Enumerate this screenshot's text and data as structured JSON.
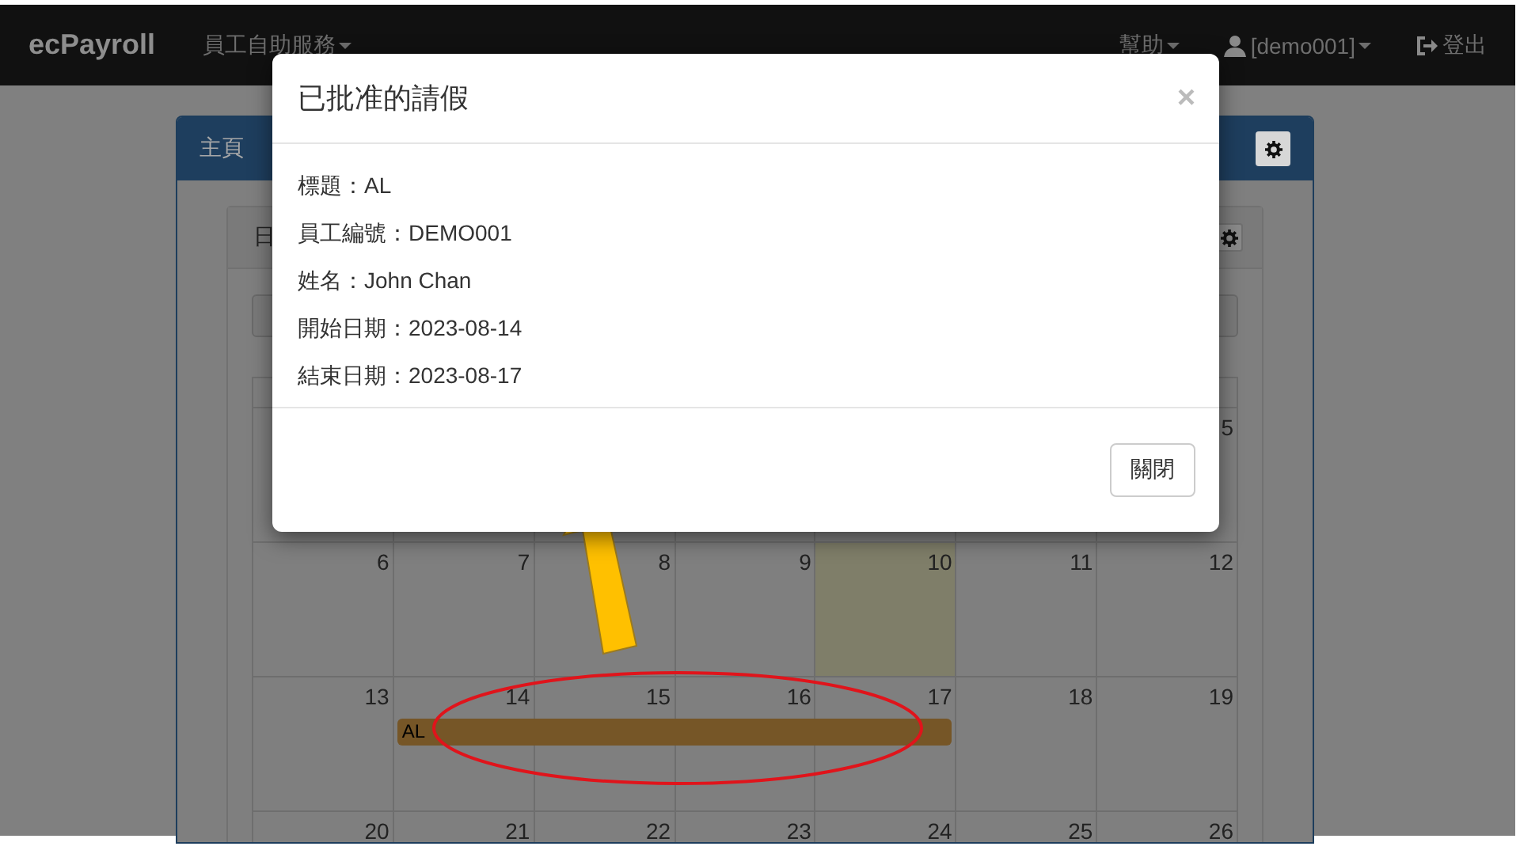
{
  "navbar": {
    "brand": "ecPayroll",
    "menu": "員工自助服務",
    "help": "幫助",
    "user": "[demo001]",
    "logout": "登出"
  },
  "panel": {
    "title": "主頁",
    "sub_title": "日"
  },
  "calendar": {
    "weeks": [
      {
        "days": [
          {
            "label": "5",
            "today": false,
            "in_event": false
          }
        ]
      },
      {
        "days": [
          {
            "label": "6",
            "today": false,
            "in_event": false
          },
          {
            "label": "7",
            "today": false,
            "in_event": false
          },
          {
            "label": "8",
            "today": false,
            "in_event": false
          },
          {
            "label": "9",
            "today": false,
            "in_event": false
          },
          {
            "label": "10",
            "today": true,
            "in_event": false
          },
          {
            "label": "11",
            "today": false,
            "in_event": false
          },
          {
            "label": "12",
            "today": false,
            "in_event": false
          }
        ]
      },
      {
        "days": [
          {
            "label": "13",
            "today": false,
            "in_event": false
          },
          {
            "label": "14",
            "today": false,
            "in_event": true
          },
          {
            "label": "15",
            "today": false,
            "in_event": true
          },
          {
            "label": "16",
            "today": false,
            "in_event": true
          },
          {
            "label": "17",
            "today": false,
            "in_event": true
          },
          {
            "label": "18",
            "today": false,
            "in_event": false
          },
          {
            "label": "19",
            "today": false,
            "in_event": false
          }
        ],
        "event": {
          "label": "AL"
        }
      },
      {
        "days": [
          {
            "label": "20",
            "today": false,
            "in_event": false
          },
          {
            "label": "21",
            "today": false,
            "in_event": false
          },
          {
            "label": "22",
            "today": false,
            "in_event": false
          },
          {
            "label": "23",
            "today": false,
            "in_event": false
          },
          {
            "label": "24",
            "today": false,
            "in_event": false
          },
          {
            "label": "25",
            "today": false,
            "in_event": false
          },
          {
            "label": "26",
            "today": false,
            "in_event": false
          }
        ]
      }
    ]
  },
  "modal": {
    "title": "已批准的請假",
    "close": "×",
    "fields": [
      {
        "label": "標題：",
        "value": "AL"
      },
      {
        "label": "員工編號：",
        "value": "DEMO001"
      },
      {
        "label": "姓名：",
        "value": "John Chan"
      },
      {
        "label": "開始日期：",
        "value": "2023-08-14"
      },
      {
        "label": "結束日期：",
        "value": "2023-08-17"
      }
    ],
    "button": "關閉"
  }
}
